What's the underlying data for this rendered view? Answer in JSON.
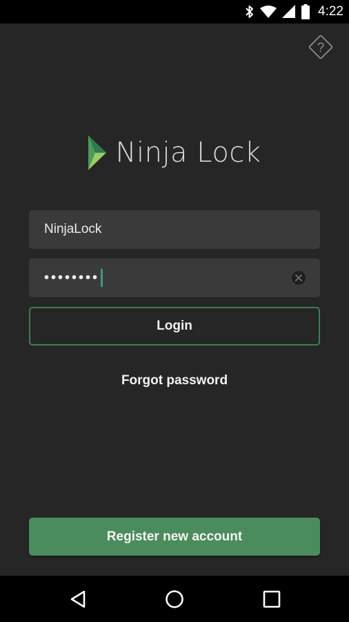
{
  "status_bar": {
    "time": "4:22",
    "icons": [
      "bluetooth-icon",
      "wifi-icon",
      "signal-icon",
      "battery-icon"
    ]
  },
  "help": {
    "icon": "help-icon",
    "glyph": "?"
  },
  "logo": {
    "text": "Ninja Lock",
    "colors": {
      "mark_dark": "#2f7a4f",
      "mark_light": "#9ccc65",
      "text": "#d9d9d9"
    }
  },
  "login_form": {
    "username_value": "NinjaLock",
    "password_mask": "••••••••",
    "login_label": "Login",
    "forgot_label": "Forgot password"
  },
  "register": {
    "label": "Register new account"
  },
  "colors": {
    "background": "#262626",
    "field": "#3a3a3a",
    "accent_green": "#4a8c5c",
    "border_green": "#3e7d55",
    "caret": "#3a9a8a"
  },
  "nav_bar": {
    "icons": [
      "back-icon",
      "home-icon",
      "recents-icon"
    ]
  }
}
